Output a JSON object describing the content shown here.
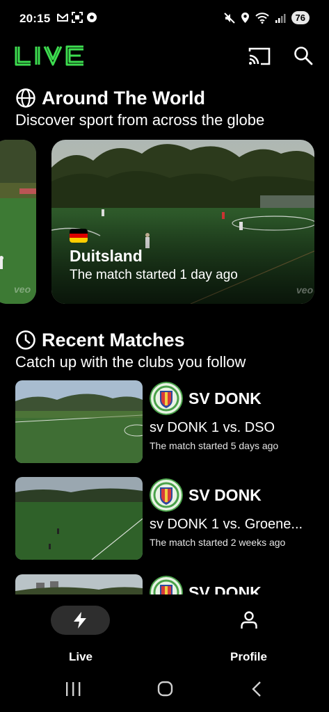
{
  "status_bar": {
    "time": "20:15",
    "battery": "76",
    "left_icons": [
      "gmail-icon",
      "screenshot-icon",
      "soccer-ball-icon"
    ],
    "right_icons": [
      "mute-icon",
      "location-icon",
      "wifi-icon",
      "signal-icon"
    ]
  },
  "header": {
    "logo_text": "LIVE",
    "accent_color": "#3ddc4f",
    "icons": [
      "cast-icon",
      "search-icon"
    ]
  },
  "around_world": {
    "icon": "globe-icon",
    "title": "Around The World",
    "subtitle": "Discover sport from across the globe",
    "cards": [
      {
        "flag": "germany-flag",
        "country": "Duitsland",
        "time": "The match started 1 day ago",
        "watermark": "veo"
      }
    ]
  },
  "recent_matches": {
    "icon": "clock-icon",
    "title": "Recent Matches",
    "subtitle": "Catch up with the clubs you follow",
    "items": [
      {
        "club": "SV DONK",
        "title": "sv DONK 1 vs. DSO",
        "time": "The match started 5 days ago"
      },
      {
        "club": "SV DONK",
        "title": "sv DONK 1 vs. Groene...",
        "time": "The match started 2 weeks ago"
      },
      {
        "club": "SV DONK",
        "title": "",
        "time": ""
      }
    ]
  },
  "bottom_nav": {
    "items": [
      {
        "label": "Live",
        "icon": "lightning-icon",
        "active": true
      },
      {
        "label": "Profile",
        "icon": "person-icon",
        "active": false
      }
    ]
  },
  "system_nav": {
    "icons": [
      "recent-apps-icon",
      "home-icon",
      "back-icon"
    ]
  }
}
